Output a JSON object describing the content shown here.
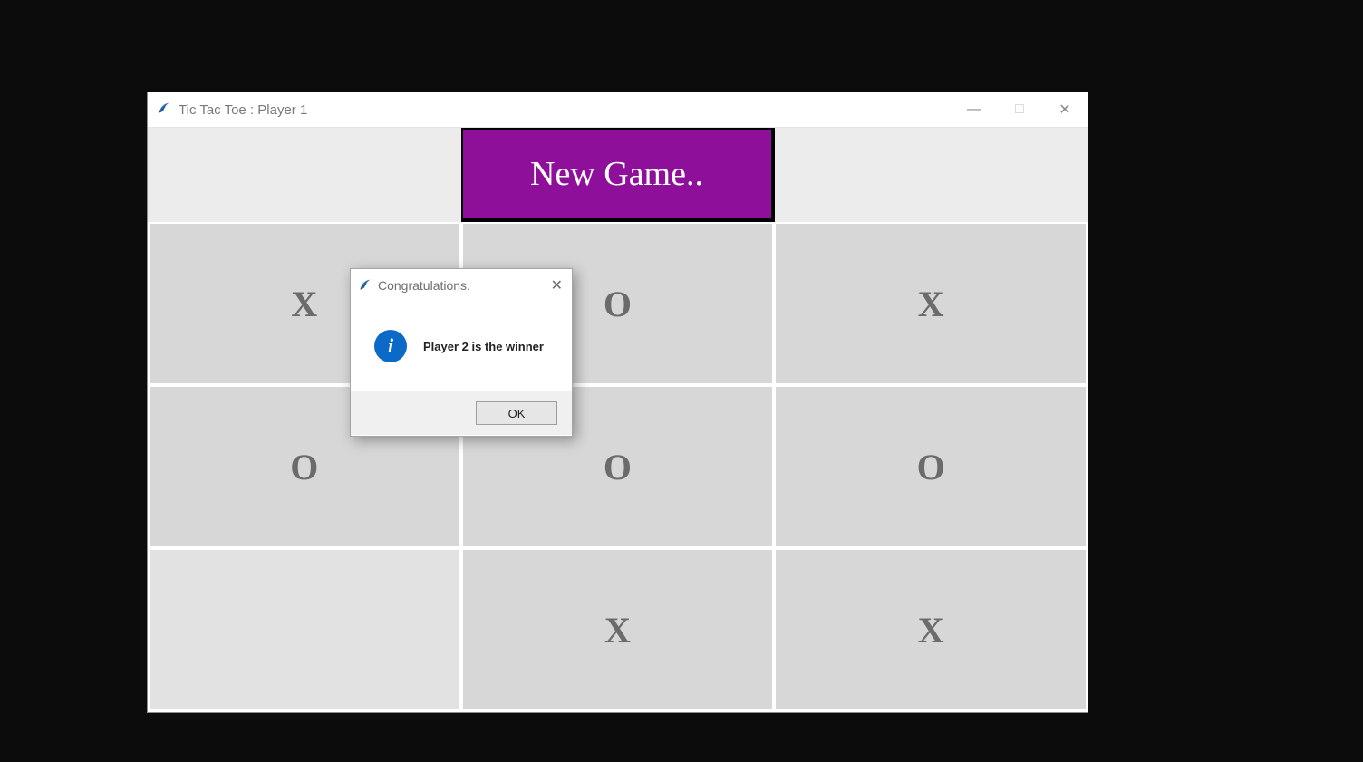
{
  "window": {
    "title": "Tic Tac Toe : Player 1",
    "controls": {
      "minimize": "—",
      "maximize": "□",
      "close": "✕"
    }
  },
  "toolbar": {
    "new_game_label": "New Game.."
  },
  "board": {
    "cells": [
      {
        "mark": "X",
        "light": false
      },
      {
        "mark": "O",
        "light": false
      },
      {
        "mark": "X",
        "light": false
      },
      {
        "mark": "O",
        "light": false
      },
      {
        "mark": "O",
        "light": false
      },
      {
        "mark": "O",
        "light": false
      },
      {
        "mark": "",
        "light": true
      },
      {
        "mark": "X",
        "light": false
      },
      {
        "mark": "X",
        "light": false
      }
    ]
  },
  "dialog": {
    "title": "Congratulations.",
    "message": "Player 2 is the winner",
    "ok_label": "OK",
    "close_glyph": "✕",
    "info_glyph": "i"
  }
}
